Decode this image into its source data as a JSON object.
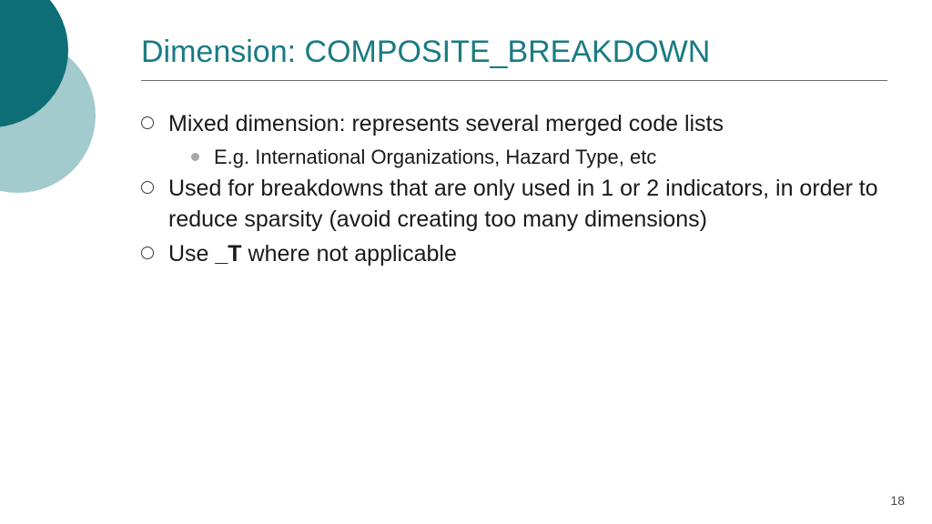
{
  "title": "Dimension: COMPOSITE_BREAKDOWN",
  "bullets": {
    "item0": "Mixed dimension: represents several merged code lists",
    "sub0": "E.g. International Organizations, Hazard Type, etc",
    "item1": "Used for breakdowns that are only used in 1 or 2 indicators, in order to reduce sparsity (avoid creating too many dimensions)",
    "item2_prefix": "Use ",
    "item2_bold": "_T",
    "item2_suffix": " where not applicable"
  },
  "page_number": "18"
}
